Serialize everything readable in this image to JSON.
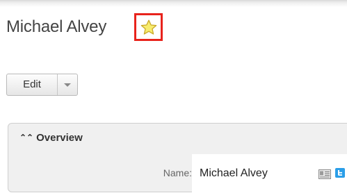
{
  "record": {
    "name": "Michael Alvey",
    "favorite_icon": "star-icon"
  },
  "actions": {
    "edit_label": "Edit",
    "dropdown_icon": "caret-down-icon"
  },
  "panel": {
    "title": "Overview",
    "toggle_icon": "double-chevron-up-icon",
    "fields": [
      {
        "label": "Name:",
        "value": "Michael Alvey",
        "icons": [
          "vcard-icon",
          "twitter-icon"
        ]
      }
    ]
  },
  "colors": {
    "highlight_border": "#e8231c",
    "star_fill": "#f7ec6e",
    "twitter_blue": "#2b9ee8"
  }
}
